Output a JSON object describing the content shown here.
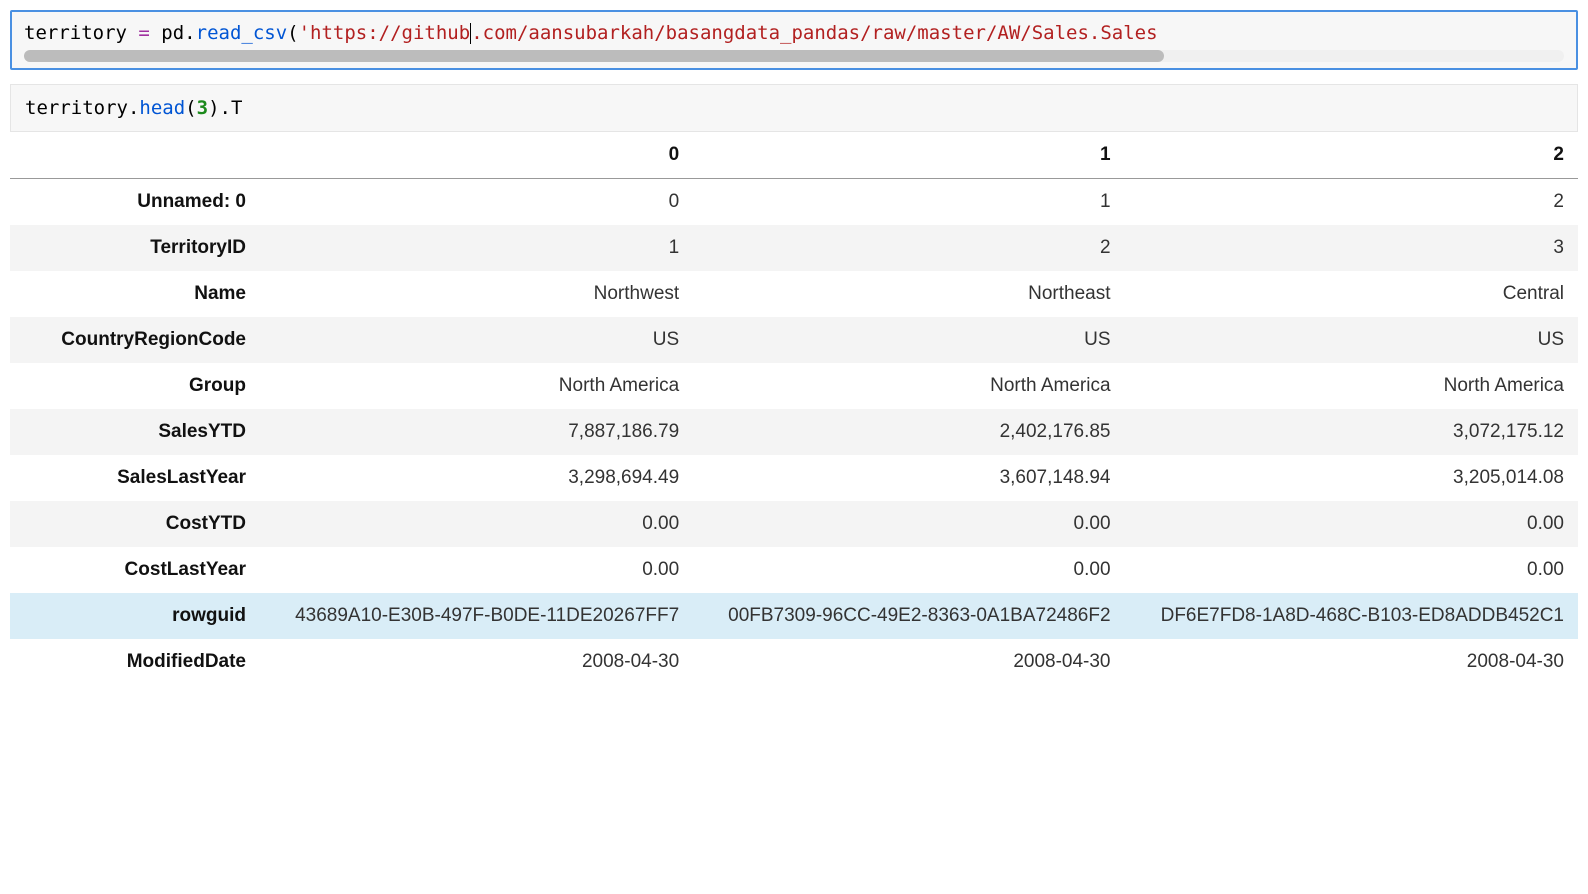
{
  "cell1": {
    "code_parts": {
      "var": "territory ",
      "op": "= ",
      "obj": "pd",
      "dot1": ".",
      "func": "read_csv",
      "lpar": "(",
      "str_a": "'https://github",
      "str_b": ".com/aansubarkah/basangdata_pandas/raw/master/AW/Sales.Sales"
    }
  },
  "cell2": {
    "code_parts": {
      "var": "territory",
      "dot1": ".",
      "func": "head",
      "lpar": "(",
      "num": "3",
      "rpar": ")",
      "dot2": ".",
      "attr": "T"
    }
  },
  "table": {
    "col_headers": [
      "",
      "0",
      "1",
      "2"
    ],
    "rows": [
      {
        "label": "Unnamed: 0",
        "cells": [
          "0",
          "1",
          "2"
        ],
        "highlight": false
      },
      {
        "label": "TerritoryID",
        "cells": [
          "1",
          "2",
          "3"
        ],
        "highlight": false
      },
      {
        "label": "Name",
        "cells": [
          "Northwest",
          "Northeast",
          "Central"
        ],
        "highlight": false
      },
      {
        "label": "CountryRegionCode",
        "cells": [
          "US",
          "US",
          "US"
        ],
        "highlight": false
      },
      {
        "label": "Group",
        "cells": [
          "North America",
          "North America",
          "North America"
        ],
        "highlight": false
      },
      {
        "label": "SalesYTD",
        "cells": [
          "7,887,186.79",
          "2,402,176.85",
          "3,072,175.12"
        ],
        "highlight": false
      },
      {
        "label": "SalesLastYear",
        "cells": [
          "3,298,694.49",
          "3,607,148.94",
          "3,205,014.08"
        ],
        "highlight": false
      },
      {
        "label": "CostYTD",
        "cells": [
          "0.00",
          "0.00",
          "0.00"
        ],
        "highlight": false
      },
      {
        "label": "CostLastYear",
        "cells": [
          "0.00",
          "0.00",
          "0.00"
        ],
        "highlight": false
      },
      {
        "label": "rowguid",
        "cells": [
          "43689A10-E30B-497F-B0DE-11DE20267FF7",
          "00FB7309-96CC-49E2-8363-0A1BA72486F2",
          "DF6E7FD8-1A8D-468C-B103-ED8ADDB452C1"
        ],
        "highlight": true
      },
      {
        "label": "ModifiedDate",
        "cells": [
          "2008-04-30",
          "2008-04-30",
          "2008-04-30"
        ],
        "highlight": false
      }
    ]
  }
}
